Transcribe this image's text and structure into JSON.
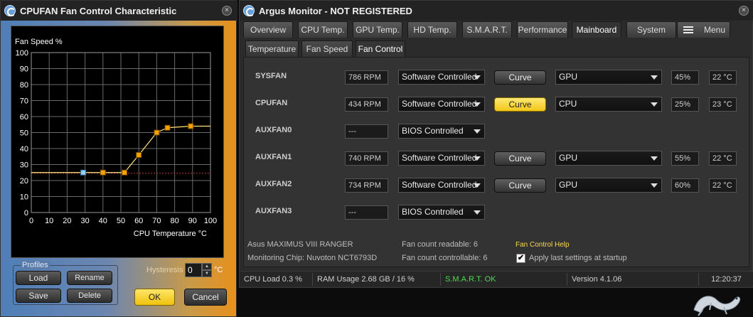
{
  "fan_window": {
    "title": "CPUFAN Fan Control Characteristic",
    "close": "×",
    "chart_data": {
      "type": "line",
      "title": "",
      "xlabel": "CPU Temperature °C",
      "ylabel": "Fan Speed %",
      "xlim": [
        0,
        100
      ],
      "ylim": [
        0,
        100
      ],
      "x_ticks": [
        0,
        10,
        20,
        30,
        40,
        50,
        60,
        70,
        80,
        90,
        100
      ],
      "y_ticks": [
        0,
        10,
        20,
        30,
        40,
        50,
        60,
        70,
        80,
        90,
        100
      ],
      "grid": true,
      "points": [
        {
          "x": 0,
          "y": 25
        },
        {
          "x": 40,
          "y": 25
        },
        {
          "x": 52,
          "y": 25
        },
        {
          "x": 60,
          "y": 36
        },
        {
          "x": 70,
          "y": 50
        },
        {
          "x": 76,
          "y": 53
        },
        {
          "x": 89,
          "y": 54
        },
        {
          "x": 100,
          "y": 54
        }
      ],
      "handle_points": [
        {
          "x": 40,
          "y": 25
        },
        {
          "x": 52,
          "y": 25
        },
        {
          "x": 60,
          "y": 36
        },
        {
          "x": 70,
          "y": 50
        },
        {
          "x": 76,
          "y": 53
        },
        {
          "x": 89,
          "y": 54
        }
      ],
      "current_point": {
        "x": 29,
        "y": 25
      },
      "hysteresis_line_y": 25,
      "line_color": "#ffe27a",
      "handle_color": "#f4a300",
      "current_color": "#8fd3ff",
      "hysteresis_color": "#b23a3a"
    },
    "profiles_label": "Profiles",
    "load": "Load",
    "rename": "Rename",
    "save": "Save",
    "delete": "Delete",
    "hysteresis_label": "Hysteresis",
    "hysteresis_value": "0",
    "hysteresis_unit": "°C",
    "ok": "OK",
    "cancel": "Cancel"
  },
  "main_window": {
    "title": "Argus Monitor - NOT REGISTERED",
    "close": "×",
    "tabs": [
      "Overview",
      "CPU Temp.",
      "GPU Temp.",
      "HD Temp.",
      "S.M.A.R.T.",
      "Performance",
      "Mainboard",
      "System",
      "Menu"
    ],
    "active_tab": "Mainboard",
    "subtabs": [
      "Temperature",
      "Fan Speed",
      "Fan Control"
    ],
    "active_subtab": "Fan Control",
    "fans": [
      {
        "name": "SYSFAN",
        "rpm": "786 RPM",
        "control": "Software Controlled",
        "curve": "Curve",
        "source": "GPU",
        "percent": "45%",
        "temp": "22 °C"
      },
      {
        "name": "CPUFAN",
        "rpm": "434 RPM",
        "control": "Software Controlled",
        "curve": "Curve",
        "source": "CPU",
        "percent": "25%",
        "temp": "23 °C"
      },
      {
        "name": "AUXFAN0",
        "rpm": "---",
        "control": "BIOS Controlled"
      },
      {
        "name": "AUXFAN1",
        "rpm": "740 RPM",
        "control": "Software Controlled",
        "curve": "Curve",
        "source": "GPU",
        "percent": "55%",
        "temp": "22 °C"
      },
      {
        "name": "AUXFAN2",
        "rpm": "734 RPM",
        "control": "Software Controlled",
        "curve": "Curve",
        "source": "GPU",
        "percent": "60%",
        "temp": "22 °C"
      },
      {
        "name": "AUXFAN3",
        "rpm": "---",
        "control": "BIOS Controlled"
      }
    ],
    "board": "Asus MAXIMUS VIII RANGER",
    "chip": "Monitoring Chip: Nuvoton NCT6793D",
    "fan_readable": "Fan count readable: 6",
    "fan_controllable": "Fan count controllable: 6",
    "help_link": "Fan Control Help",
    "apply_label": "Apply last settings at startup",
    "apply_checked": "✔",
    "status": {
      "cpu_load": "CPU Load 0.3 %",
      "ram": "RAM Usage 2.68 GB / 16 %",
      "smart": "S.M.A.R.T. OK",
      "version": "Version 4.1.06",
      "time": "12:20:37"
    }
  }
}
